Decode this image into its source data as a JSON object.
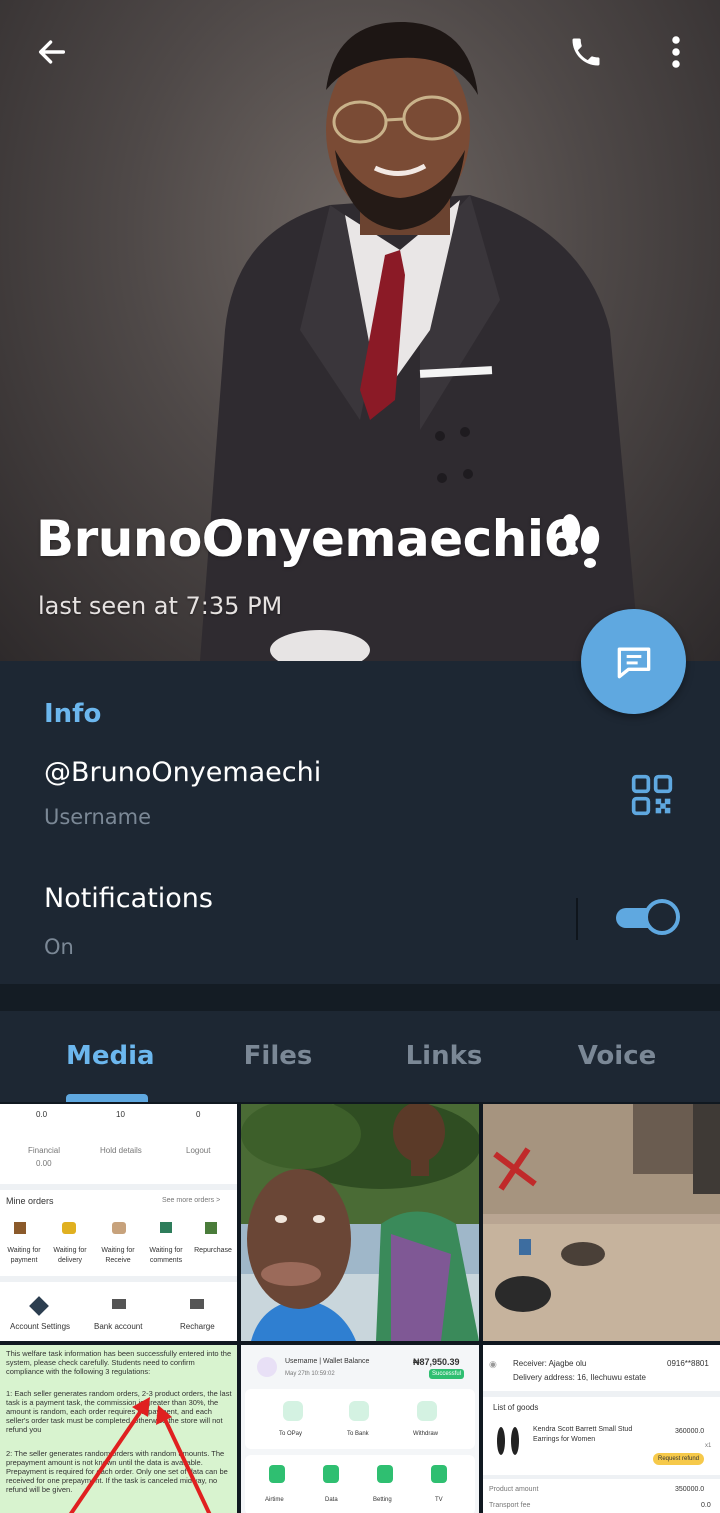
{
  "header": {
    "name": "BrunoOnyemaechi6",
    "status": "last seen at 7:35 PM",
    "icons": [
      "back-arrow-icon",
      "phone-icon",
      "more-vertical-icon",
      "footprints-emoji-icon",
      "message-icon"
    ]
  },
  "info": {
    "title": "Info",
    "username": "@BrunoOnyemaechi",
    "username_label": "Username",
    "notifications_label": "Notifications",
    "notifications_value": "On",
    "notifications_enabled": true
  },
  "tabs": [
    {
      "label": "Media",
      "active": true
    },
    {
      "label": "Files",
      "active": false
    },
    {
      "label": "Links",
      "active": false
    },
    {
      "label": "Voice",
      "active": false
    }
  ],
  "media": {
    "cell1": {
      "stats": [
        "0.0",
        "10",
        "0"
      ],
      "row2": [
        "Financial",
        "Hold details",
        "Logout"
      ],
      "row2_value": "0.00",
      "section": "Mine orders",
      "section_link": "See more orders >",
      "orders": [
        "Waiting for payment",
        "Waiting for delivery",
        "Waiting for Receive",
        "Waiting for comments",
        "Repurchase"
      ],
      "bottom": [
        "Account Settings",
        "Bank account",
        "Recharge"
      ]
    },
    "cell4": {
      "paragraph1": "This welfare task information has been successfully entered into the system, please check carefully. Students need to confirm compliance with the following 3 regulations:",
      "paragraph2": "1: Each seller generates random orders, 2-3 product orders, the last task is a payment task, the commission is greater than 30%, the amount is random, each order requires prepayment, and each seller's order task must be completed, otherwise the store will not refund you",
      "paragraph3": "2: The seller generates random orders with random amounts. The prepayment amount is not known until the data is available. Prepayment is required for each order. Only one set of data can be received for one prepayment. If the task is canceled midway, no refund will be given."
    },
    "cell5": {
      "title": "Username | Wallet Balance",
      "date": "May 27th 10:59:02",
      "amount": "₦87,950.39",
      "badge": "Successful",
      "actions": [
        "To OPay",
        "To Bank",
        "Withdraw"
      ],
      "services": [
        "Airtime",
        "Data",
        "Betting",
        "TV"
      ]
    },
    "cell6": {
      "receiver": "Receiver:  Ajagbe olu",
      "phone": "0916**8801",
      "address": "Delivery address:  16, Ilechuwu estate",
      "list_title": "List of goods",
      "item": "Kendra Scott Barrett Small Stud Earrings for Women",
      "item_price": "360000.0",
      "item_qty": "x1",
      "button": "Request refund",
      "product_amount_label": "Product amount",
      "product_amount": "350000.0",
      "transport_label": "Transport fee",
      "transport": "0.0"
    }
  }
}
